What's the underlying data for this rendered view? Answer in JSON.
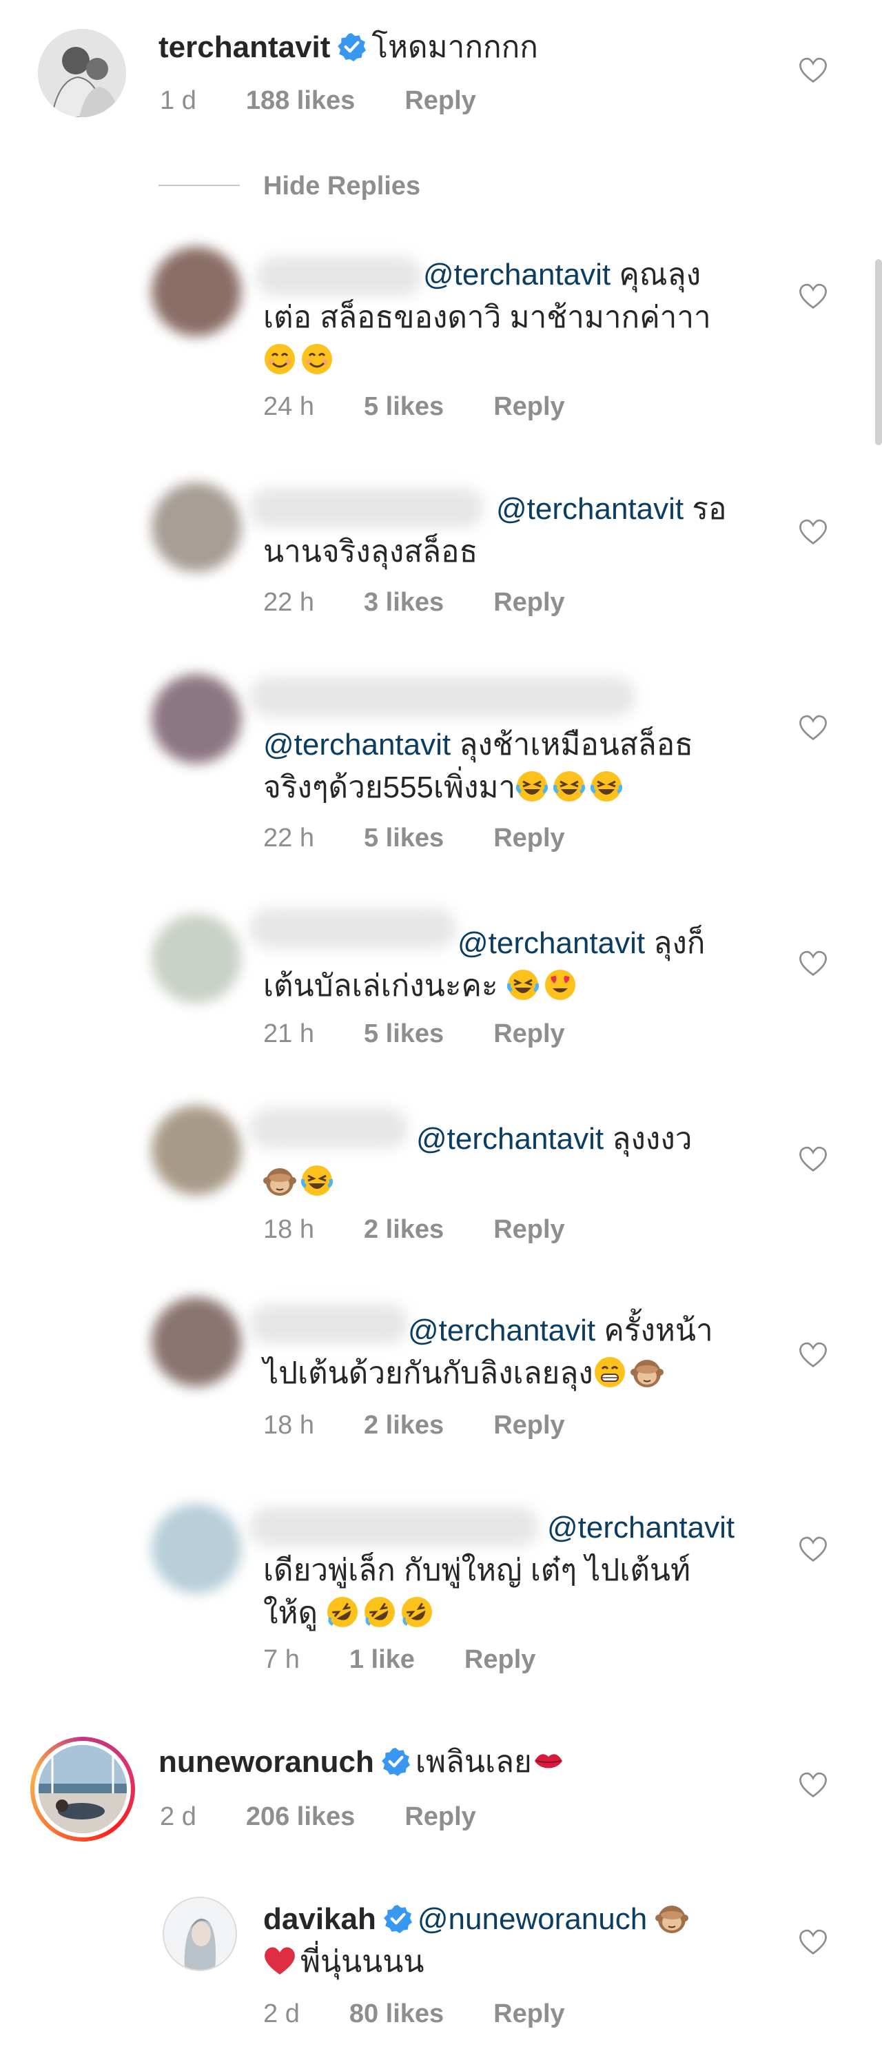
{
  "comments": [
    {
      "username": "terchantavit",
      "text": "โหดมากกกก",
      "time": "1 d",
      "likes": "188 likes",
      "reply": "Reply"
    },
    {
      "username": "nuneworanuch",
      "text": "เพลินเลย",
      "time": "2 d",
      "likes": "206 likes",
      "reply": "Reply"
    }
  ],
  "hide_replies": "Hide Replies",
  "replies": [
    {
      "mention": "@terchantavit",
      "line1": "คุณลุง",
      "line2": "เต่อ สล็อธของดาวิ  มาช้ามากค่าาา",
      "time": "24 h",
      "likes": "5 likes",
      "reply": "Reply",
      "avatar_color": "#8a6e66"
    },
    {
      "mention": "@terchantavit",
      "line1": "รอ",
      "line2": "นานจริงลุงสล็อธ",
      "time": "22 h",
      "likes": "3 likes",
      "reply": "Reply",
      "avatar_color": "#a69d95"
    },
    {
      "mention": "@terchantavit",
      "line1": "ลุงช้าเหมือนสล็อธ",
      "line2": "จริงๆด้วย555เพิ่งมา",
      "time": "22 h",
      "likes": "5 likes",
      "reply": "Reply",
      "avatar_color": "#8c7680"
    },
    {
      "mention": "@terchantavit",
      "line1": "ลุงก็",
      "line2": "เต้นบัลเล่เก่งนะคะ",
      "time": "21 h",
      "likes": "5 likes",
      "reply": "Reply",
      "avatar_color": "#c9d1c6"
    },
    {
      "mention": "@terchantavit",
      "line1": "ลุงงงว",
      "line2": "",
      "time": "18 h",
      "likes": "2 likes",
      "reply": "Reply",
      "avatar_color": "#a89a88"
    },
    {
      "mention": "@terchantavit",
      "line1": "ครั้งหน้า",
      "line2": "ไปเต้นด้วยกันกับลิงเลยลุง",
      "time": "18 h",
      "likes": "2 likes",
      "reply": "Reply",
      "avatar_color": "#8a7470"
    },
    {
      "mention": "@terchantavit",
      "line1": "",
      "line2": "เดียวพู่เล็ก กับพู่ใหญ่ เต๋ๆ ไปเต้นท์",
      "line3": "ให้ดู",
      "time": "7 h",
      "likes": "1 like",
      "reply": "Reply",
      "avatar_color": "#b7cdd8"
    }
  ],
  "davikah": {
    "username": "davikah",
    "mention": "@nuneworanuch",
    "text": "พี่นุ่นนนน",
    "time": "2 d",
    "likes": "80 likes",
    "reply": "Reply"
  },
  "colors": {
    "mention": "#0b3d63",
    "meta": "#8e8e8e",
    "verified": "#3897f0",
    "heart": "#8e8e8e"
  },
  "icons": [
    "verified-badge-icon",
    "heart-icon",
    "smile-emoji-icon",
    "laugh-cry-emoji-icon",
    "heart-eyes-emoji-icon",
    "see-no-evil-monkey-icon",
    "grin-emoji-icon",
    "rofl-emoji-icon",
    "lips-emoji-icon",
    "red-heart-emoji-icon"
  ]
}
